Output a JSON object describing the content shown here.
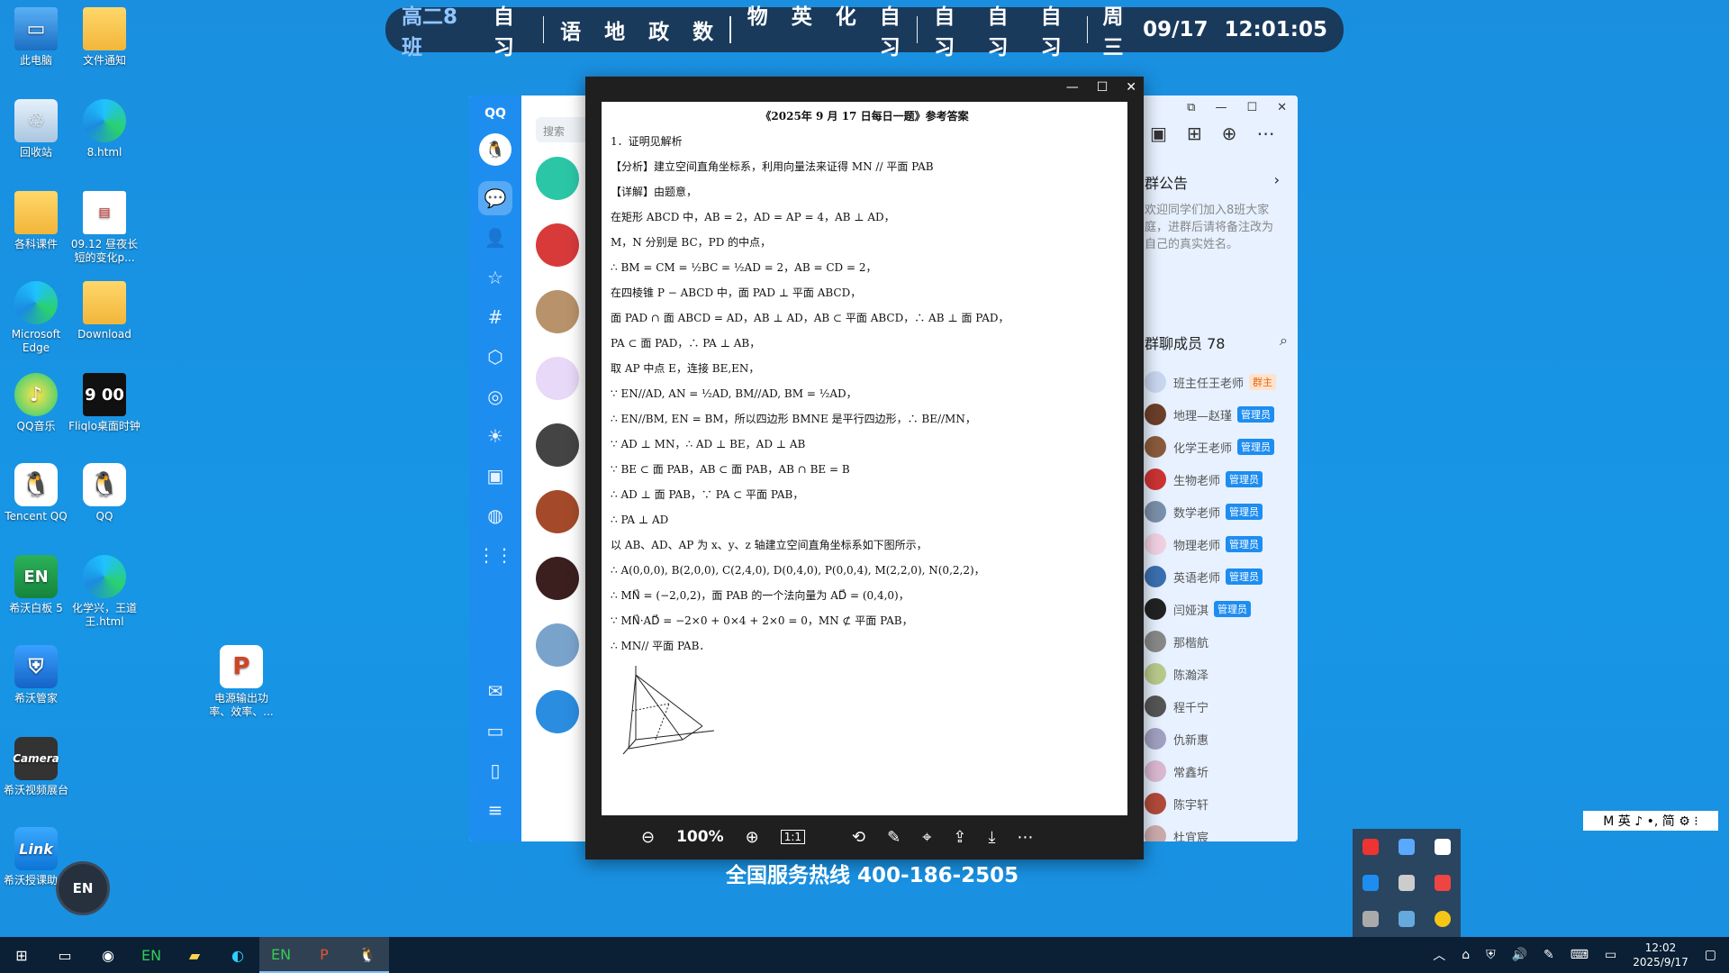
{
  "schedule": {
    "class": "高二8班",
    "groups": [
      [
        "自习"
      ],
      [
        "语",
        "地",
        "政",
        "数"
      ],
      [
        "物",
        "英",
        "化",
        "自习"
      ],
      [
        "自习",
        "自习",
        "自习"
      ]
    ],
    "day": "周三",
    "date": "09/17",
    "time": "12:01:05"
  },
  "desktop": [
    {
      "label": "此电脑",
      "icon": "pc"
    },
    {
      "label": "文件通知",
      "icon": "folder"
    },
    {
      "label": "回收站",
      "icon": "bin"
    },
    {
      "label": "8.html",
      "icon": "edge"
    },
    {
      "label": "各科课件",
      "icon": "folder"
    },
    {
      "label": "09.12 昼夜长短的变化p...",
      "icon": "doc"
    },
    {
      "label": "Microsoft Edge",
      "icon": "edge"
    },
    {
      "label": "Download",
      "icon": "folder"
    },
    {
      "label": "QQ音乐",
      "icon": "qqm"
    },
    {
      "label": "Fliqlo桌面时钟",
      "icon": "clock"
    },
    {
      "label": "Tencent QQ",
      "icon": "qq"
    },
    {
      "label": "QQ",
      "icon": "qq"
    },
    {
      "label": "希沃白板 5",
      "icon": "en"
    },
    {
      "label": "化学兴，王道王.html",
      "icon": "edge"
    },
    {
      "label": "希沃管家",
      "icon": "shield"
    },
    {
      "label": "电源输出功率、效率、...",
      "icon": "ppt"
    },
    {
      "label": "希沃视频展台",
      "icon": "cam"
    },
    {
      "label": "希沃授课助手",
      "icon": "link"
    }
  ],
  "qq": {
    "logo": "QQ",
    "search_placeholder": "搜索",
    "announcement_title": "群公告",
    "announcement_text": "欢迎同学们加入8班大家庭，进群后请将备注改为自己的真实姓名。",
    "members_title": "群聊成员 78",
    "members": [
      {
        "name": "班主任王老师",
        "tag": "群主"
      },
      {
        "name": "地理—赵瑾",
        "tag": "管理员"
      },
      {
        "name": "化学王老师",
        "tag": "管理员"
      },
      {
        "name": "生物老师",
        "tag": "管理员"
      },
      {
        "name": "数学老师",
        "tag": "管理员"
      },
      {
        "name": "物理老师",
        "tag": "管理员"
      },
      {
        "name": "英语老师",
        "tag": "管理员"
      },
      {
        "name": "闫娅淇",
        "tag": "管理员"
      },
      {
        "name": "那楷航",
        "tag": ""
      },
      {
        "name": "陈瀚泽",
        "tag": ""
      },
      {
        "name": "程千宁",
        "tag": ""
      },
      {
        "name": "仇新惠",
        "tag": ""
      },
      {
        "name": "常鑫圻",
        "tag": ""
      },
      {
        "name": "陈宇轩",
        "tag": ""
      },
      {
        "name": "杜宜宸",
        "tag": ""
      }
    ]
  },
  "viewer": {
    "title": "《2025年 9 月 17 日每日一题》参考答案",
    "lines": [
      "1．证明见解析",
      "【分析】建立空间直角坐标系，利用向量法来证得 MN // 平面 PAB",
      "【详解】由题意，",
      "在矩形 ABCD 中，AB = 2，AD = AP = 4，AB ⊥ AD，",
      "M，N 分别是 BC，PD 的中点，",
      "∴ BM = CM = ½BC = ½AD = 2，AB = CD = 2，",
      "在四棱锥 P − ABCD 中，面 PAD ⊥ 平面 ABCD，",
      "面 PAD ∩ 面 ABCD = AD，AB ⊥ AD，AB ⊂ 平面 ABCD，∴ AB ⊥ 面 PAD，",
      "PA ⊂ 面 PAD，∴ PA ⊥ AB，",
      "取 AP 中点 E，连接 BE,EN，",
      "∵ EN//AD, AN = ½AD, BM//AD, BM = ½AD，",
      "∴ EN//BM, EN = BM，所以四边形 BMNE 是平行四边形，∴ BE//MN，",
      "∵ AD ⊥ MN，∴ AD ⊥ BE，AD ⊥ AB",
      "∵ BE ⊂ 面 PAB，AB ⊂ 面 PAB，AB ∩ BE = B",
      "∴ AD ⊥ 面 PAB，∵ PA ⊂ 平面 PAB，",
      "∴ PA ⊥ AD",
      "以 AB、AD、AP 为 x、y、z 轴建立空间直角坐标系如下图所示，",
      "∴ A(0,0,0), B(2,0,0), C(2,4,0), D(0,4,0), P(0,0,4), M(2,2,0), N(0,2,2)，",
      "∴ MN⃗ = (−2,0,2)，面 PAB 的一个法向量为 AD⃗ = (0,4,0)，",
      "∵ MN⃗·AD⃗ = −2×0 + 0×4 + 2×0 = 0，MN ⊄ 平面 PAB，",
      "∴ MN// 平面 PAB．"
    ],
    "zoom": "100%",
    "ratio": "1:1"
  },
  "hotline": "全国服务热线 400-186-2505",
  "ime": "M 英 ♪ •, 简 ⚙ ⁝",
  "taskbar": {
    "time": "12:02",
    "date": "2025/9/17",
    "enball": "EN"
  }
}
